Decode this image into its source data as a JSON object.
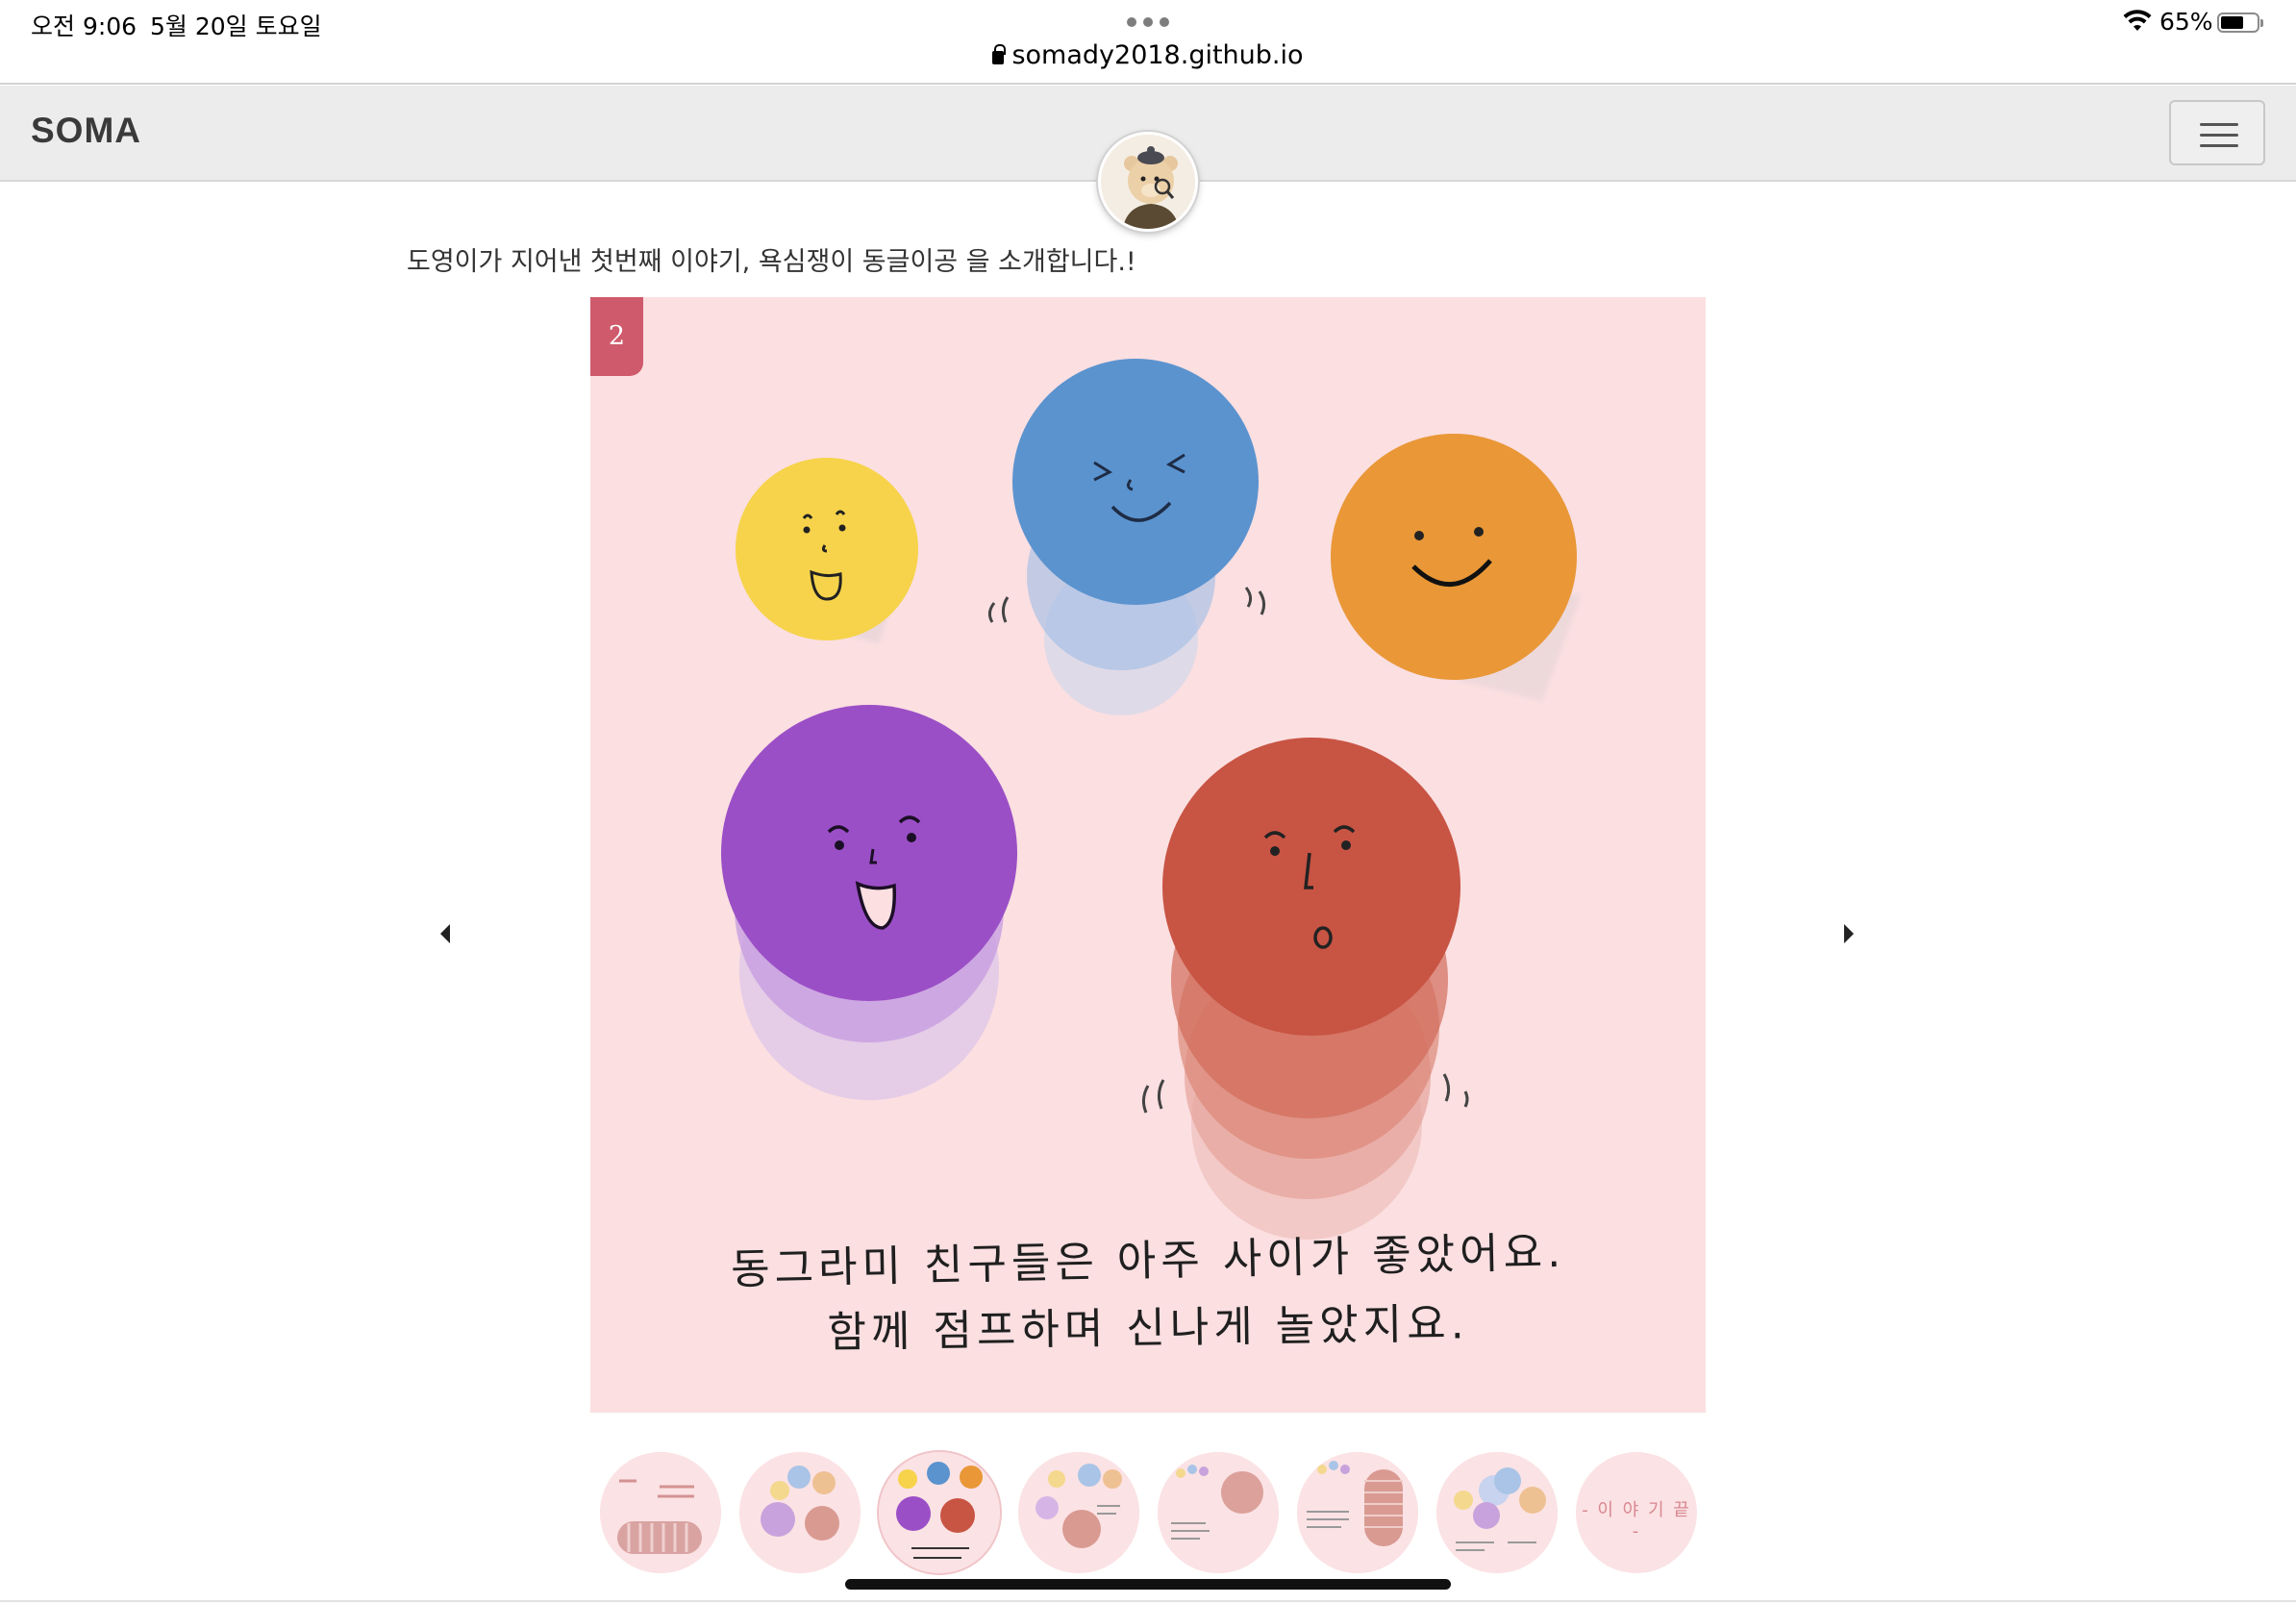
{
  "status": {
    "time": "오전 9:06",
    "date": "5월 20일 토요일",
    "battery_percent": "65%",
    "battery_level": 0.65
  },
  "browser": {
    "url": "somady2018.github.io"
  },
  "site": {
    "brand": "SOMA",
    "menu_icon": "hamburger-icon"
  },
  "intro_text": "도영이가 지어낸 첫번째 이야기, 욕심쟁이 동글이공 을 소개합니다.!",
  "carousel": {
    "slide_number": "2",
    "caption_line1": "동그라미 친구들은 아주 사이가 좋았어요.",
    "caption_line2": "함께 점프하며 신나게 놀았지요.",
    "prev_icon": "caret-left-icon",
    "next_icon": "caret-right-icon",
    "colors": {
      "yellow": "#f6d34a",
      "blue": "#5b93cf",
      "orange": "#e99737",
      "purple": "#9b4fc6",
      "red": "#c85443",
      "background": "#fbdfe1"
    }
  },
  "thumbnails": {
    "active_index": 2,
    "count": 8,
    "end_label": "- 이 야 기 끝 -"
  }
}
